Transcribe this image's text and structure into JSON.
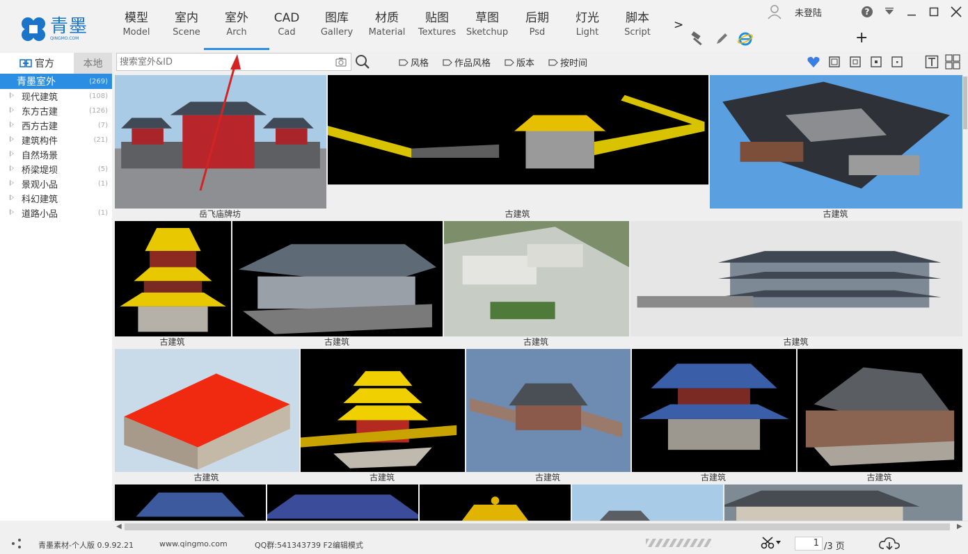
{
  "app": {
    "logo_cn": "青墨",
    "logo_en": "QINGMO.COM",
    "user_status": "未登陆"
  },
  "nav_tabs": [
    {
      "cn": "模型",
      "en": "Model"
    },
    {
      "cn": "室内",
      "en": "Scene"
    },
    {
      "cn": "室外",
      "en": "Arch",
      "active": true
    },
    {
      "cn": "CAD",
      "en": "Cad"
    },
    {
      "cn": "图库",
      "en": "Gallery"
    },
    {
      "cn": "材质",
      "en": "Material"
    },
    {
      "cn": "贴图",
      "en": "Textures"
    },
    {
      "cn": "草图",
      "en": "Sketchup"
    },
    {
      "cn": "后期",
      "en": "Psd"
    },
    {
      "cn": "灯光",
      "en": "Light"
    },
    {
      "cn": "脚本",
      "en": "Script"
    }
  ],
  "nav_more": ">",
  "toolbar": {
    "tab_official": "官方",
    "tab_local": "本地",
    "search_placeholder": "搜索室外&ID",
    "filters": [
      "风格",
      "作品风格",
      "版本",
      "按时间"
    ]
  },
  "sidebar": {
    "root": {
      "label": "青墨室外",
      "count": "(269)"
    },
    "items": [
      {
        "label": "现代建筑",
        "count": "(108)"
      },
      {
        "label": "东方古建",
        "count": "(126)"
      },
      {
        "label": "西方古建",
        "count": "(7)"
      },
      {
        "label": "建筑构件",
        "count": "(21)"
      },
      {
        "label": "自然场景",
        "count": ""
      },
      {
        "label": "桥梁堤坝",
        "count": "(5)"
      },
      {
        "label": "景观小品",
        "count": "(1)"
      },
      {
        "label": "科幻建筑",
        "count": ""
      },
      {
        "label": "道路小品",
        "count": "(1)"
      }
    ]
  },
  "cards": [
    {
      "caption": "岳飞庙牌坊",
      "theme": "gate"
    },
    {
      "caption": "古建筑",
      "theme": "wall"
    },
    {
      "caption": "古建筑",
      "theme": "courtyard"
    },
    {
      "caption": "古建筑",
      "theme": "pagoda"
    },
    {
      "caption": "古建筑",
      "theme": "hall"
    },
    {
      "caption": "古建筑",
      "theme": "aerial"
    },
    {
      "caption": "古建筑",
      "theme": "long"
    },
    {
      "caption": "古建筑",
      "theme": "redroof"
    },
    {
      "caption": "古建筑",
      "theme": "tower"
    },
    {
      "caption": "古建筑",
      "theme": "bluegrey"
    },
    {
      "caption": "古建筑",
      "theme": "bluepav"
    },
    {
      "caption": "古建筑",
      "theme": "greyhall"
    },
    {
      "caption": "",
      "theme": "p1"
    },
    {
      "caption": "",
      "theme": "p2"
    },
    {
      "caption": "",
      "theme": "p3"
    },
    {
      "caption": "",
      "theme": "p4"
    },
    {
      "caption": "",
      "theme": "p5"
    }
  ],
  "status": {
    "version": "青墨素材-个人版 0.9.92.21",
    "website": "www.qingmo.com",
    "qq": "QQ群:541343739 F2编辑模式",
    "page": "1",
    "total_pages": "/3 页"
  },
  "colors": {
    "accent": "#2b8ee3",
    "logo": "#1a74c8"
  }
}
